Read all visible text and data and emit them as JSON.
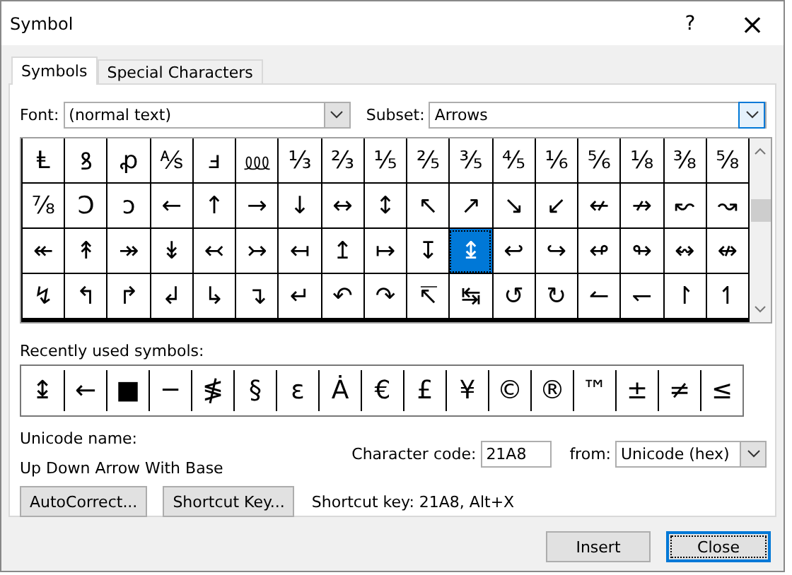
{
  "window": {
    "title": "Symbol",
    "help": "?",
    "close": "×"
  },
  "tabs": [
    {
      "label": "Symbols",
      "selected": true
    },
    {
      "label": "Special Characters",
      "selected": false
    }
  ],
  "font": {
    "label": "Font:",
    "value": "(normal text)"
  },
  "subset": {
    "label": "Subset:",
    "value": "Arrows"
  },
  "symbols": [
    {
      "char": "Ⱡ",
      "selected": false
    },
    {
      "char": "ꝸ",
      "selected": false
    },
    {
      "char": "ꝓ",
      "selected": false
    },
    {
      "char": "⅍",
      "selected": false
    },
    {
      "char": "ⅎ",
      "selected": false
    },
    {
      "char": "⅏",
      "selected": false
    },
    {
      "char": "⅓",
      "selected": false
    },
    {
      "char": "⅔",
      "selected": false
    },
    {
      "char": "⅕",
      "selected": false
    },
    {
      "char": "⅖",
      "selected": false
    },
    {
      "char": "⅗",
      "selected": false
    },
    {
      "char": "⅘",
      "selected": false
    },
    {
      "char": "⅙",
      "selected": false
    },
    {
      "char": "⅚",
      "selected": false
    },
    {
      "char": "⅛",
      "selected": false
    },
    {
      "char": "⅜",
      "selected": false
    },
    {
      "char": "⅝",
      "selected": false
    },
    {
      "char": "⅞",
      "selected": false
    },
    {
      "char": "Ↄ",
      "selected": false
    },
    {
      "char": "ↄ",
      "selected": false
    },
    {
      "char": "←",
      "selected": false
    },
    {
      "char": "↑",
      "selected": false
    },
    {
      "char": "→",
      "selected": false
    },
    {
      "char": "↓",
      "selected": false
    },
    {
      "char": "↔",
      "selected": false
    },
    {
      "char": "↕",
      "selected": false
    },
    {
      "char": "↖",
      "selected": false
    },
    {
      "char": "↗",
      "selected": false
    },
    {
      "char": "↘",
      "selected": false
    },
    {
      "char": "↙",
      "selected": false
    },
    {
      "char": "↚",
      "selected": false
    },
    {
      "char": "↛",
      "selected": false
    },
    {
      "char": "↜",
      "selected": false
    },
    {
      "char": "↝",
      "selected": false
    },
    {
      "char": "↞",
      "selected": false
    },
    {
      "char": "↟",
      "selected": false
    },
    {
      "char": "↠",
      "selected": false
    },
    {
      "char": "↡",
      "selected": false
    },
    {
      "char": "↢",
      "selected": false
    },
    {
      "char": "↣",
      "selected": false
    },
    {
      "char": "↤",
      "selected": false
    },
    {
      "char": "↥",
      "selected": false
    },
    {
      "char": "↦",
      "selected": false
    },
    {
      "char": "↧",
      "selected": false
    },
    {
      "char": "↨",
      "selected": true
    },
    {
      "char": "↩",
      "selected": false
    },
    {
      "char": "↪",
      "selected": false
    },
    {
      "char": "↫",
      "selected": false
    },
    {
      "char": "↬",
      "selected": false
    },
    {
      "char": "↭",
      "selected": false
    },
    {
      "char": "↮",
      "selected": false
    },
    {
      "char": "↯",
      "selected": false
    },
    {
      "char": "↰",
      "selected": false
    },
    {
      "char": "↱",
      "selected": false
    },
    {
      "char": "↲",
      "selected": false
    },
    {
      "char": "↳",
      "selected": false
    },
    {
      "char": "↴",
      "selected": false
    },
    {
      "char": "↵",
      "selected": false
    },
    {
      "char": "↶",
      "selected": false
    },
    {
      "char": "↷",
      "selected": false
    },
    {
      "char": "↸",
      "selected": false
    },
    {
      "char": "↹",
      "selected": false
    },
    {
      "char": "↺",
      "selected": false
    },
    {
      "char": "↻",
      "selected": false
    },
    {
      "char": "↼",
      "selected": false
    },
    {
      "char": "↽",
      "selected": false
    },
    {
      "char": "↾",
      "selected": false
    },
    {
      "char": "↿",
      "selected": false
    }
  ],
  "recently_used": {
    "label": "Recently used symbols:",
    "symbols": [
      "↨",
      "←",
      "■",
      "─",
      "≸",
      "§",
      "ε",
      "Ȧ",
      "€",
      "£",
      "¥",
      "©",
      "®",
      "™",
      "±",
      "≠",
      "≤"
    ]
  },
  "unicode_name": {
    "label": "Unicode name:",
    "value": "Up Down Arrow With Base"
  },
  "character_code": {
    "label": "Character code:",
    "value": "21A8"
  },
  "from": {
    "label": "from:",
    "value": "Unicode (hex)"
  },
  "buttons": [
    "AutoCorrect...",
    "Shortcut Key..."
  ],
  "shortcut_key": "Shortcut key: 21A8, Alt+X",
  "footer_buttons": [
    {
      "label": "Insert",
      "default": false
    },
    {
      "label": "Close",
      "default": true
    }
  ]
}
